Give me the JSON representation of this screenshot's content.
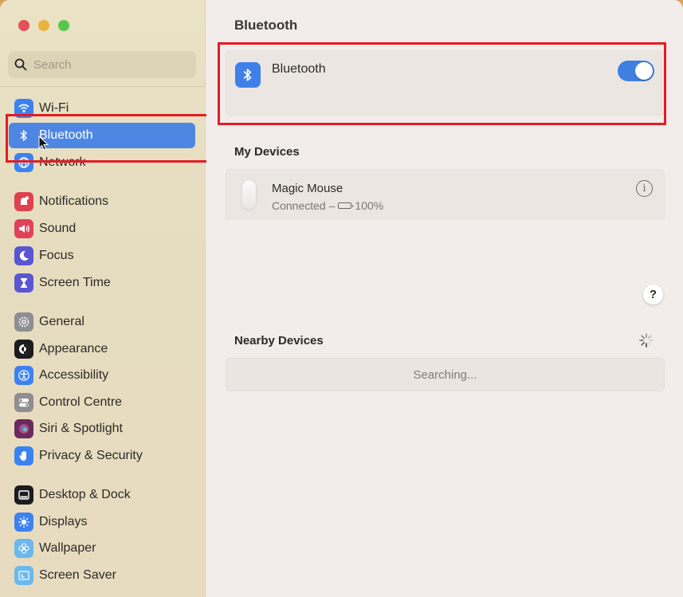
{
  "window": {
    "traffic_lights": [
      "close",
      "minimize",
      "maximize"
    ]
  },
  "sidebar": {
    "search": {
      "placeholder": "Search",
      "value": "",
      "icon": "search-icon"
    },
    "items": [
      {
        "label": "Wi-Fi",
        "icon": "wifi-icon",
        "color": "#3b82f0",
        "selected": false
      },
      {
        "label": "Bluetooth",
        "icon": "bluetooth-icon",
        "color": "#3b82f0",
        "selected": true
      },
      {
        "label": "Network",
        "icon": "globe-icon",
        "color": "#3b82f0",
        "selected": false
      },
      {
        "label": "Notifications",
        "icon": "bell-icon",
        "color": "#e0414e",
        "selected": false
      },
      {
        "label": "Sound",
        "icon": "speaker-icon",
        "color": "#e0415b",
        "selected": false
      },
      {
        "label": "Focus",
        "icon": "moon-icon",
        "color": "#5a55d2",
        "selected": false
      },
      {
        "label": "Screen Time",
        "icon": "hourglass-icon",
        "color": "#5a55d2",
        "selected": false
      },
      {
        "label": "General",
        "icon": "gear-icon",
        "color": "#8e8e93",
        "selected": false
      },
      {
        "label": "Appearance",
        "icon": "appearance-icon",
        "color": "#1c1c1e",
        "selected": false
      },
      {
        "label": "Accessibility",
        "icon": "accessibility-icon",
        "color": "#3b82f0",
        "selected": false
      },
      {
        "label": "Control Centre",
        "icon": "toggles-icon",
        "color": "#8e8e93",
        "selected": false
      },
      {
        "label": "Siri & Spotlight",
        "icon": "siri-icon",
        "color": "#6b2a5e",
        "selected": false
      },
      {
        "label": "Privacy & Security",
        "icon": "hand-icon",
        "color": "#3b82f0",
        "selected": false
      },
      {
        "label": "Desktop & Dock",
        "icon": "dock-icon",
        "color": "#1c1c1e",
        "selected": false
      },
      {
        "label": "Displays",
        "icon": "sun-icon",
        "color": "#3b82f0",
        "selected": false
      },
      {
        "label": "Wallpaper",
        "icon": "flower-icon",
        "color": "#6cb8ec",
        "selected": false
      },
      {
        "label": "Screen Saver",
        "icon": "screensaver-icon",
        "color": "#6cb8ec",
        "selected": false
      }
    ]
  },
  "main": {
    "title": "Bluetooth",
    "bluetooth_row": {
      "label": "Bluetooth",
      "toggle_on": true,
      "accent": "#3f7fe2"
    },
    "my_devices": {
      "title": "My Devices",
      "devices": [
        {
          "name": "Magic Mouse",
          "status": "Connected –",
          "battery": "100%",
          "battery_level": 1.0
        }
      ]
    },
    "help_label": "?",
    "nearby_devices": {
      "title": "Nearby Devices",
      "searching_text": "Searching..."
    }
  }
}
